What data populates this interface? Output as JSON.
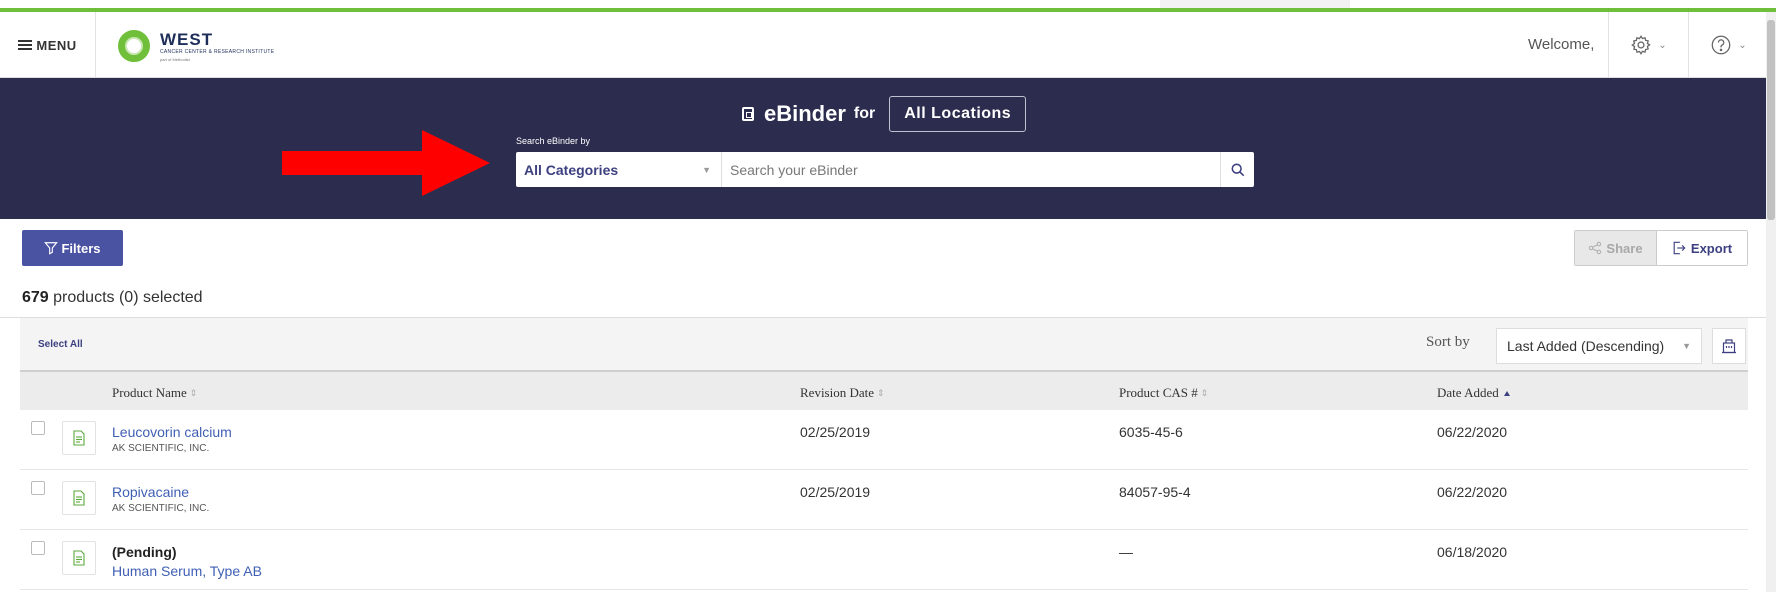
{
  "header": {
    "menu_label": "MENU",
    "logo_name": "WEST",
    "logo_sub": "CANCER CENTER & RESEARCH INSTITUTE",
    "logo_tiny": "part of Methodist",
    "welcome": "Welcome,"
  },
  "banner": {
    "brand": "eBinder",
    "for_label": "for",
    "location_button": "All Locations",
    "search_by_label": "Search eBinder by",
    "category_value": "All Categories",
    "search_placeholder": "Search your eBinder"
  },
  "toolbar": {
    "filters_label": "Filters",
    "share_label": "Share",
    "export_label": "Export"
  },
  "summary": {
    "count": "679",
    "text": " products (0) selected"
  },
  "list": {
    "select_all": "Select All",
    "sort_by_label": "Sort by",
    "sort_value": "Last Added (Descending)"
  },
  "table": {
    "columns": [
      "Product Name",
      "Revision Date",
      "Product CAS #",
      "Date Added"
    ],
    "rows": [
      {
        "pending": "",
        "name": "Leucovorin calcium",
        "manufacturer": "AK SCIENTIFIC, INC.",
        "revision_date": "02/25/2019",
        "cas": "6035-45-6",
        "date_added": "06/22/2020"
      },
      {
        "pending": "",
        "name": "Ropivacaine",
        "manufacturer": "AK SCIENTIFIC, INC.",
        "revision_date": "02/25/2019",
        "cas": "84057-95-4",
        "date_added": "06/22/2020"
      },
      {
        "pending": "(Pending)",
        "name": "Human Serum, Type AB",
        "manufacturer": "",
        "revision_date": "",
        "cas": "—",
        "date_added": "06/18/2020"
      }
    ]
  },
  "colors": {
    "accent_green": "#6fbf3a",
    "banner_bg": "#2c2c4f",
    "primary_button": "#4a52a2",
    "link_blue": "#3f5fb5",
    "annotation_arrow": "#ff0000"
  }
}
